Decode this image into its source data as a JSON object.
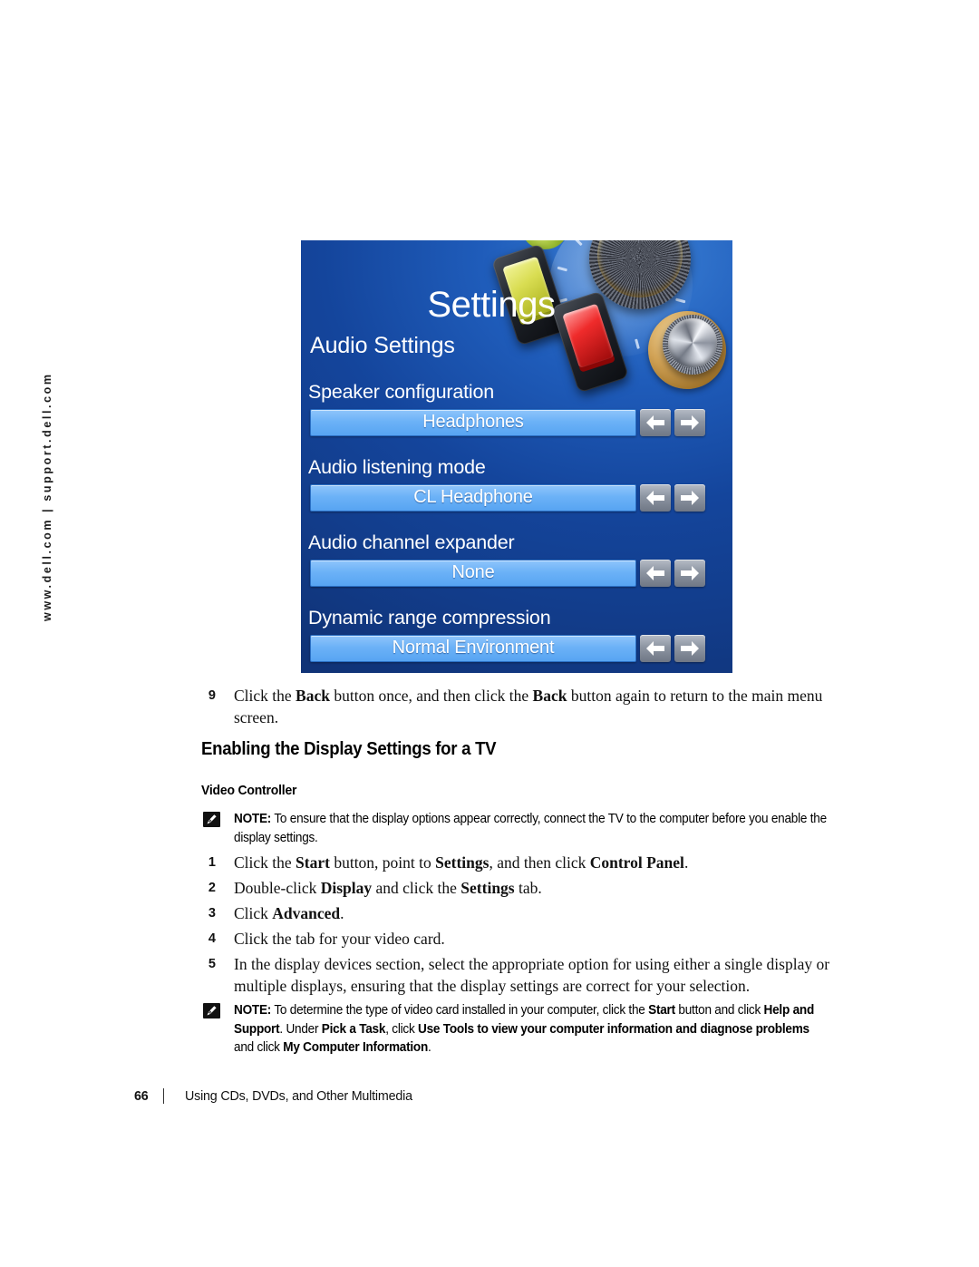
{
  "side_rail": {
    "text": "www.dell.com | support.dell.com"
  },
  "figure": {
    "title": "Settings",
    "subtitle": "Audio Settings",
    "rows": [
      {
        "label": "Speaker configuration",
        "value": "Headphones"
      },
      {
        "label": "Audio listening mode",
        "value": "CL Headphone"
      },
      {
        "label": "Audio channel expander",
        "value": "None"
      },
      {
        "label": "Dynamic range compression",
        "value": "Normal Environment"
      }
    ],
    "arrow_left_icon": "arrow-left-icon",
    "arrow_right_icon": "arrow-right-icon",
    "colors": {
      "background_blue": "#14459c",
      "bar_blue": "#6cb2f7",
      "arrow_button_gray": "#8d95a2"
    }
  },
  "content": {
    "step9": {
      "number": "9",
      "text_html": "Click the <b>Back</b> button once, and then click the <b>Back</b> button again to return to the main menu screen."
    },
    "section_heading": "Enabling the Display Settings for a TV",
    "sub_heading": "Video Controller",
    "note1": {
      "lead": "NOTE:",
      "text_html": "To ensure that the display options appear correctly, connect the TV to the computer before you enable the display settings.",
      "icon": "note-pencil-icon"
    },
    "steps": [
      {
        "number": "1",
        "text_html": "Click the <b>Start</b> button, point to <b>Settings</b>, and then click <b>Control Panel</b>."
      },
      {
        "number": "2",
        "text_html": "Double-click <b>Display</b> and click the <b>Settings</b> tab."
      },
      {
        "number": "3",
        "text_html": "Click <b>Advanced</b>."
      },
      {
        "number": "4",
        "text_html": "Click the tab for your video card."
      },
      {
        "number": "5",
        "text_html": "In the display devices section, select the appropriate option for using either a single display or multiple displays, ensuring that the display settings are correct for your selection."
      }
    ],
    "note2": {
      "lead": "NOTE:",
      "text_html": "To determine the type of video card installed in your computer, click the <b>Start</b> button and click <b>Help and Support</b>. Under <b>Pick a Task</b>, click <b>Use Tools to view your computer information and diagnose problems</b> and click <b>My Computer Information</b>.",
      "icon": "note-pencil-icon"
    }
  },
  "footer": {
    "page_number": "66",
    "separator": "|",
    "chapter": "Using CDs, DVDs, and Other Multimedia"
  }
}
